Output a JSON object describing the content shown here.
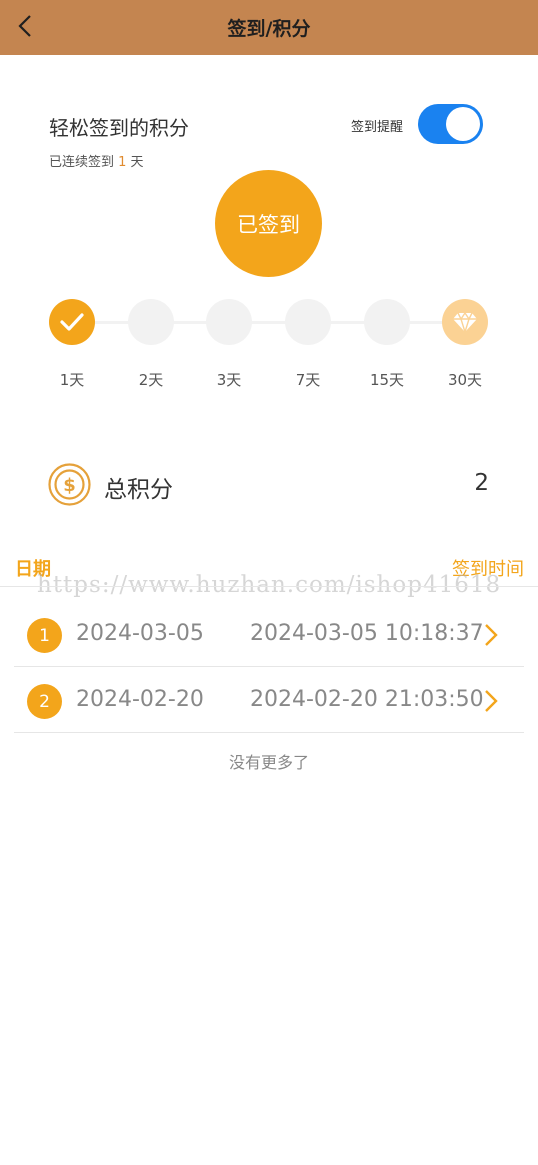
{
  "header": {
    "title": "签到/积分"
  },
  "checkin": {
    "title": "轻松签到的积分",
    "streak_prefix": "已连续签到 ",
    "streak_count": "1",
    "streak_suffix": " 天",
    "reminder_label": "签到提醒",
    "reminder_on": true,
    "button_label": "已签到"
  },
  "milestones": [
    {
      "label": "1天",
      "state": "done",
      "icon": "check-icon"
    },
    {
      "label": "2天",
      "state": "pending"
    },
    {
      "label": "3天",
      "state": "pending"
    },
    {
      "label": "7天",
      "state": "pending"
    },
    {
      "label": "15天",
      "state": "pending"
    },
    {
      "label": "30天",
      "state": "prize",
      "icon": "diamond-icon"
    }
  ],
  "total": {
    "label": "总积分",
    "value": "2",
    "icon": "coin-dollar-icon"
  },
  "list": {
    "col_date": "日期",
    "col_time": "签到时间",
    "rows": [
      {
        "index": "1",
        "date": "2024-03-05",
        "time": "2024-03-05 10:18:37"
      },
      {
        "index": "2",
        "date": "2024-02-20",
        "time": "2024-02-20 21:03:50"
      }
    ],
    "no_more": "没有更多了"
  },
  "watermark": "https://www.huzhan.com/ishop41618",
  "colors": {
    "header": "#c48550",
    "accent": "#f3a51b",
    "toggle": "#1a82f0"
  }
}
